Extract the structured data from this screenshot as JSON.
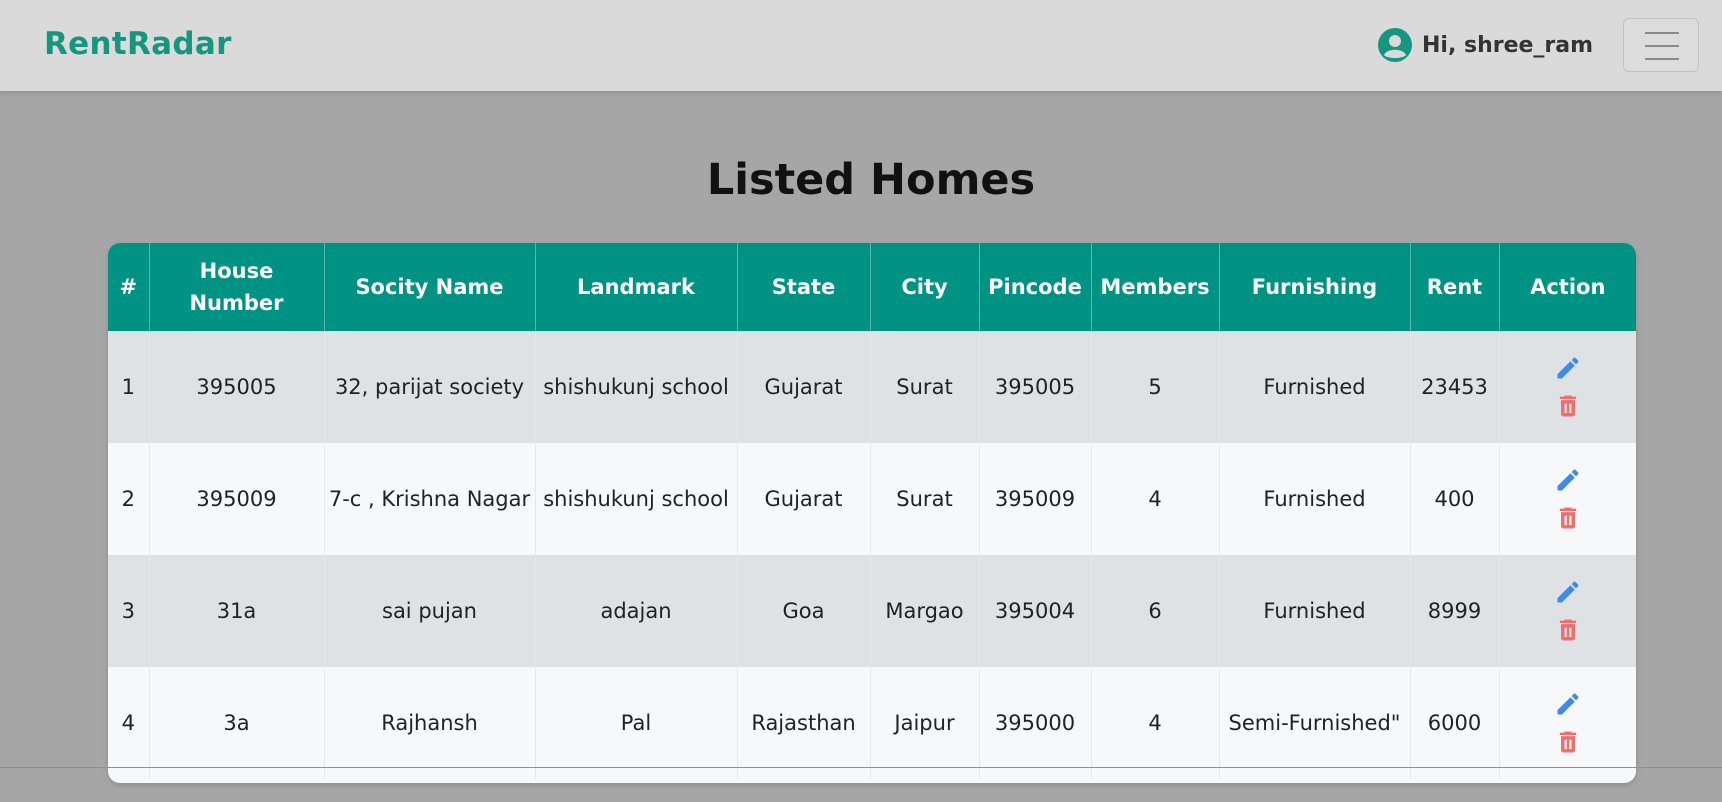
{
  "navbar": {
    "brand": "RentRadar",
    "greeting": "Hi, shree_ram",
    "brand_color": "#16967e"
  },
  "page": {
    "title": "Listed Homes"
  },
  "table": {
    "header_color": "#009383",
    "columns": [
      "#",
      "House Number",
      "Socity Name",
      "Landmark",
      "State",
      "City",
      "Pincode",
      "Members",
      "Furnishing",
      "Rent",
      "Action"
    ],
    "rows": [
      {
        "index": "1",
        "house_number": "395005",
        "society": "32, parijat society",
        "landmark": "shishukunj school",
        "state": "Gujarat",
        "city": "Surat",
        "pincode": "395005",
        "members": "5",
        "furnishing": "Furnished",
        "rent": "23453"
      },
      {
        "index": "2",
        "house_number": "395009",
        "society": "7-c , Krishna Nagar",
        "landmark": "shishukunj school",
        "state": "Gujarat",
        "city": "Surat",
        "pincode": "395009",
        "members": "4",
        "furnishing": "Furnished",
        "rent": "400"
      },
      {
        "index": "3",
        "house_number": "31a",
        "society": "sai pujan",
        "landmark": "adajan",
        "state": "Goa",
        "city": "Margao",
        "pincode": "395004",
        "members": "6",
        "furnishing": "Furnished",
        "rent": "8999"
      },
      {
        "index": "4",
        "house_number": "3a",
        "society": "Rajhansh",
        "landmark": "Pal",
        "state": "Rajasthan",
        "city": "Jaipur",
        "pincode": "395000",
        "members": "4",
        "furnishing": "Semi-Furnished\"",
        "rent": "6000"
      }
    ],
    "actions": {
      "edit_icon": "pencil-icon",
      "delete_icon": "trash-icon",
      "edit_color": "#3d8bf0",
      "delete_color": "#f06d6d"
    }
  }
}
